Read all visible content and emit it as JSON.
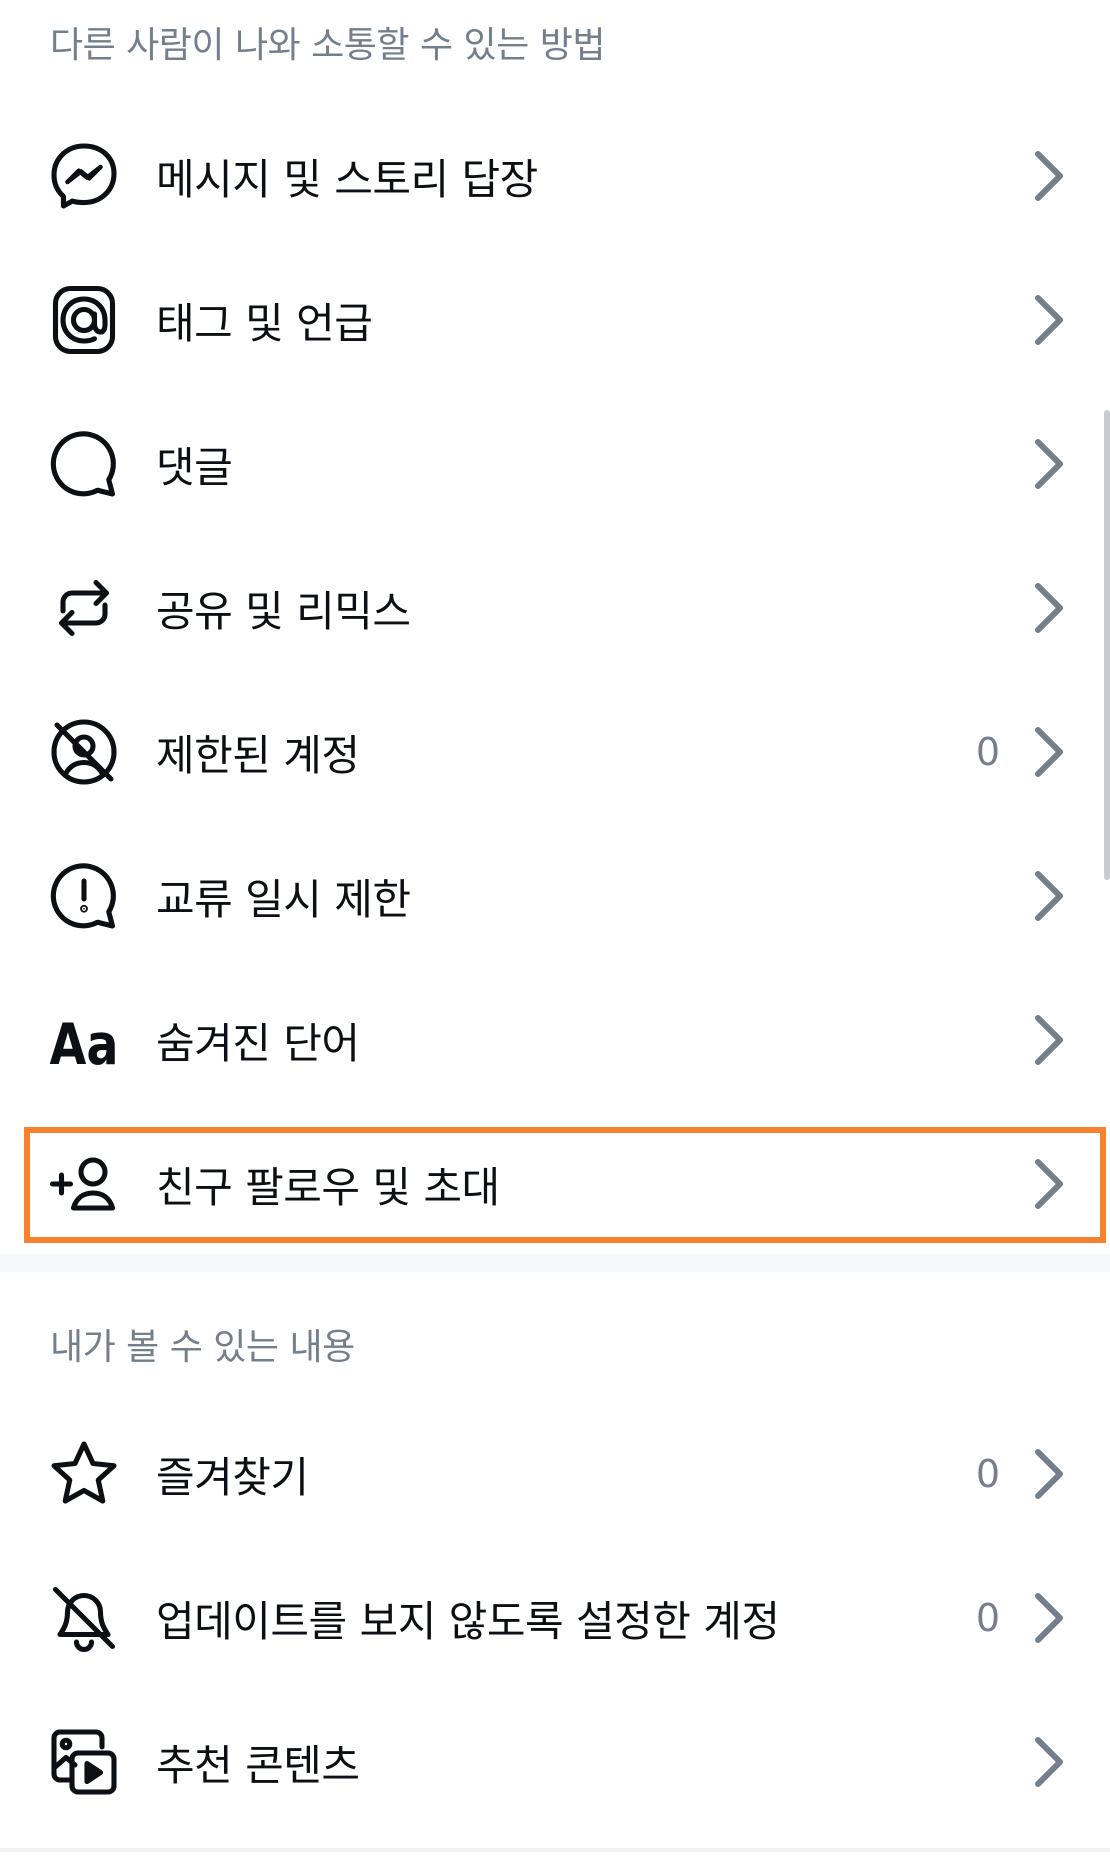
{
  "sections": [
    {
      "header": "다른 사람이 나와 소통할 수 있는 방법",
      "items": [
        {
          "icon": "messenger-icon",
          "label": "메시지 및 스토리 답장",
          "count": null
        },
        {
          "icon": "at-sign-icon",
          "label": "태그 및 언급",
          "count": null
        },
        {
          "icon": "comment-bubble-icon",
          "label": "댓글",
          "count": null
        },
        {
          "icon": "repost-icon",
          "label": "공유 및 리믹스",
          "count": null
        },
        {
          "icon": "restricted-icon",
          "label": "제한된 계정",
          "count": "0"
        },
        {
          "icon": "limit-alert-icon",
          "label": "교류 일시 제한",
          "count": null
        },
        {
          "icon": "text-aa-icon",
          "label": "숨겨진 단어",
          "count": null
        },
        {
          "icon": "add-friend-icon",
          "label": "친구 팔로우 및 초대",
          "count": null,
          "highlighted": true
        }
      ]
    },
    {
      "header": "내가 볼 수 있는 내용",
      "items": [
        {
          "icon": "star-icon",
          "label": "즐겨찾기",
          "count": "0"
        },
        {
          "icon": "muted-bell-icon",
          "label": "업데이트를 보지 않도록 설정한 계정",
          "count": "0"
        },
        {
          "icon": "suggested-content-icon",
          "label": "추천 콘텐츠",
          "count": null
        }
      ]
    }
  ],
  "colors": {
    "highlight": "#f7822e",
    "header_text": "#737f8c",
    "primary_text": "#0c1014"
  }
}
